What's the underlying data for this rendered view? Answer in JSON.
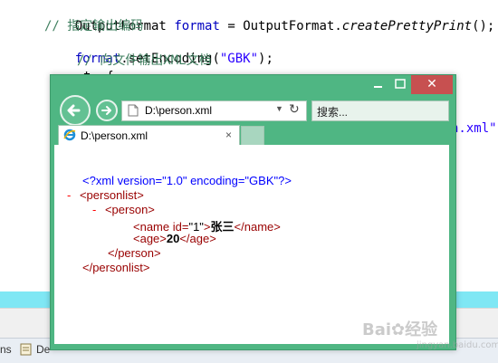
{
  "code": {
    "line1": {
      "type": "OutputFormat",
      "var": "format",
      "eq": " = ",
      "cls": "OutputFormat.",
      "method": "createPrettyPrint",
      "end": "();"
    },
    "line2": {
      "comment": "// 指定输出编码"
    },
    "line3": {
      "var": "format",
      "call": ".setEncoding(",
      "str": "\"GBK\"",
      "end": ");"
    },
    "line4": {
      "comment": "// 向文件输出XML文档"
    },
    "line5": {
      "fragment": "t  {"
    },
    "right_fragment": "n.xml\""
  },
  "ide": {
    "tab1": "ns",
    "tab2": "De"
  },
  "browser": {
    "minimize_icon": "minimize-icon",
    "maximize_icon": "maximize-icon",
    "close_label": "✕",
    "address": "D:\\person.xml",
    "search_placeholder": "搜索...",
    "tab_title": "D:\\person.xml",
    "tab_close": "×"
  },
  "xml": {
    "declaration": "<?xml version=\"1.0\" encoding=\"GBK\"?>",
    "collapse_marker": "-",
    "personlist_open": "<personlist>",
    "person_open": "<person>",
    "name_open_tag": "<name",
    "name_attr": " id=",
    "name_attr_value": "\"1\"",
    "name_close_bracket": ">",
    "name_text": "张三",
    "name_close": "</name>",
    "age_open": "<age>",
    "age_text": "20",
    "age_close": "</age>",
    "person_close": "</person>",
    "personlist_close": "</personlist>"
  },
  "watermark": {
    "main": "Bai✿经验",
    "sub": "jingyan.baidu.com"
  },
  "colors": {
    "window_green": "#4fb683",
    "close_red": "#c75050",
    "cyan_bar": "#7fe7f4"
  }
}
